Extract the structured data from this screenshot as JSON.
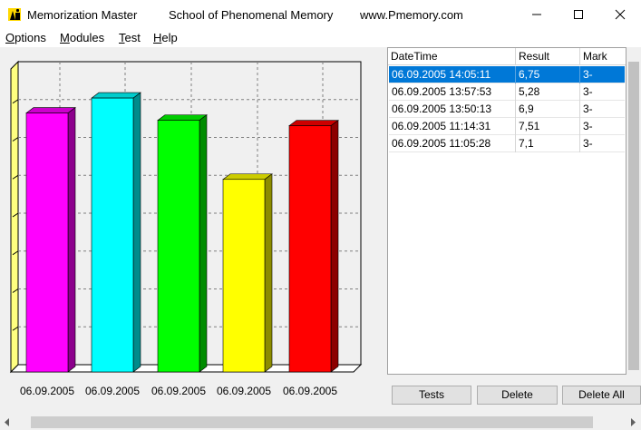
{
  "window": {
    "title_app": "Memorization Master",
    "title_school": "School of Phenomenal Memory",
    "title_url": "www.Pmemory.com",
    "icons": [
      "app-icon",
      "minimize-icon",
      "maximize-icon",
      "close-icon"
    ]
  },
  "menu": {
    "items": [
      {
        "accel": "O",
        "rest": "ptions"
      },
      {
        "accel": "M",
        "rest": "odules"
      },
      {
        "accel": "T",
        "rest": "est"
      },
      {
        "accel": "H",
        "rest": "elp"
      }
    ]
  },
  "chart_data": {
    "type": "bar",
    "categories": [
      "06.09.2005",
      "06.09.2005",
      "06.09.2005",
      "06.09.2005",
      "06.09.2005"
    ],
    "values": [
      7.1,
      7.51,
      6.9,
      5.28,
      6.75
    ],
    "colors": [
      "#ff00ff",
      "#00ffff",
      "#00ff00",
      "#ffff00",
      "#ff0000"
    ],
    "ylim": [
      0,
      10
    ],
    "grid": true,
    "legend": "none"
  },
  "table": {
    "headers": [
      "DateTime",
      "Result",
      "Mark"
    ],
    "rows": [
      [
        "06.09.2005 14:05:11",
        "6,75",
        "3-"
      ],
      [
        "06.09.2005 13:57:53",
        "5,28",
        "3-"
      ],
      [
        "06.09.2005 13:50:13",
        "6,9",
        "3-"
      ],
      [
        "06.09.2005 11:14:31",
        "7,51",
        "3-"
      ],
      [
        "06.09.2005 11:05:28",
        "7,1",
        "3-"
      ]
    ],
    "selected_row": 0
  },
  "buttons": {
    "tests": "Tests",
    "delete": "Delete",
    "delete_all": "Delete All"
  }
}
